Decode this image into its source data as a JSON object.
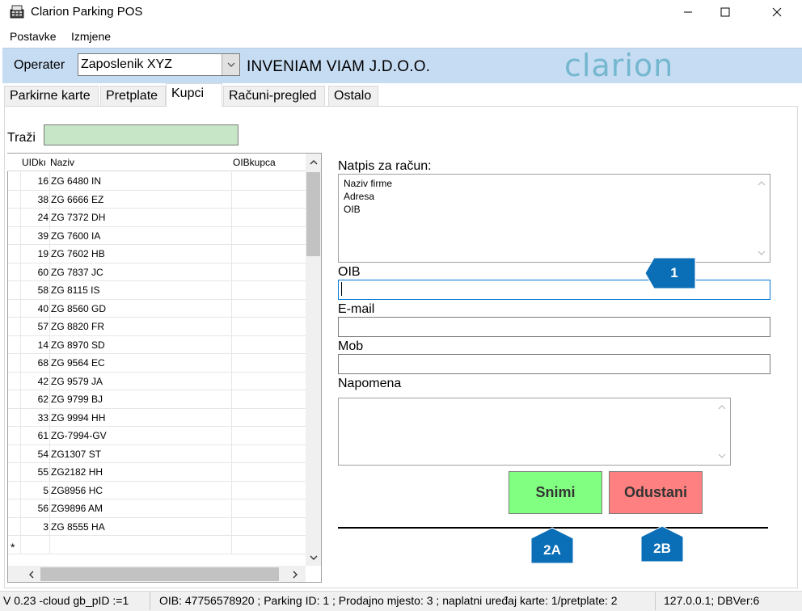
{
  "window": {
    "title": "Clarion Parking POS"
  },
  "menu": [
    "Postavke",
    "Izmjene"
  ],
  "header": {
    "operater_label": "Operater",
    "operater_value": "Zaposlenik XYZ",
    "company": "INVENIAM VIAM J.D.O.O.",
    "logo_text": "clarion"
  },
  "tabs": [
    {
      "label": "Parkirne karte"
    },
    {
      "label": "Pretplate"
    },
    {
      "label": "Kupci"
    },
    {
      "label": "Računi-pregled"
    },
    {
      "label": "Ostalo"
    }
  ],
  "search": {
    "label": "Traži",
    "value": ""
  },
  "grid": {
    "columns": [
      "UIDkı",
      "Naziv",
      "OIBkupca"
    ],
    "rows": [
      {
        "id": "16",
        "naziv": "ZG 6480 IN"
      },
      {
        "id": "38",
        "naziv": "ZG 6666 EZ"
      },
      {
        "id": "24",
        "naziv": "ZG 7372 DH"
      },
      {
        "id": "39",
        "naziv": "ZG 7600 IA"
      },
      {
        "id": "19",
        "naziv": "ZG 7602 HB"
      },
      {
        "id": "60",
        "naziv": "ZG 7837 JC"
      },
      {
        "id": "58",
        "naziv": "ZG 8115 IS"
      },
      {
        "id": "40",
        "naziv": "ZG 8560 GD"
      },
      {
        "id": "57",
        "naziv": "ZG 8820 FR"
      },
      {
        "id": "14",
        "naziv": "ZG 8970 SD"
      },
      {
        "id": "68",
        "naziv": "ZG 9564 EC"
      },
      {
        "id": "42",
        "naziv": "ZG 9579 JA"
      },
      {
        "id": "62",
        "naziv": "ZG 9799 BJ"
      },
      {
        "id": "33",
        "naziv": "ZG 9994 HH"
      },
      {
        "id": "61",
        "naziv": "ZG-7994-GV"
      },
      {
        "id": "54",
        "naziv": "ZG1307 ST"
      },
      {
        "id": "55",
        "naziv": "ZG2182 HH"
      },
      {
        "id": "5",
        "naziv": "ZG8956 HC"
      },
      {
        "id": "56",
        "naziv": "ZG9896 AM"
      },
      {
        "id": "3",
        "naziv": "ZG 8555 HA"
      }
    ],
    "new_row_marker": "*"
  },
  "form": {
    "natpis_label": "Natpis za račun:",
    "natpis_lines": [
      "Naziv firme",
      "Adresa",
      "OIB"
    ],
    "oib_label": "OIB",
    "oib_value": "",
    "email_label": "E-mail",
    "email_value": "",
    "mob_label": "Mob",
    "mob_value": "",
    "napomena_label": "Napomena",
    "napomena_value": ""
  },
  "buttons": {
    "save": "Snimi",
    "cancel": "Odustani"
  },
  "callouts": {
    "c1": "1",
    "c2a": "2A",
    "c2b": "2B"
  },
  "status": {
    "version": "V 0.23 -cloud gb_pID :=1",
    "info": "OIB: 47756578920 ; Parking ID: 1 ; Prodajno mjesto: 3 ; naplatni uređaj karte: 1/pretplate: 2",
    "db": "127.0.0.1; DBVer:6"
  },
  "colors": {
    "header_bg": "#c6dcf3",
    "search_bg": "#c7e6c7",
    "save_bg": "#80ff80",
    "cancel_bg": "#ff8080",
    "callout_bg": "#0a6fb7",
    "logo": "#74b7cf"
  }
}
